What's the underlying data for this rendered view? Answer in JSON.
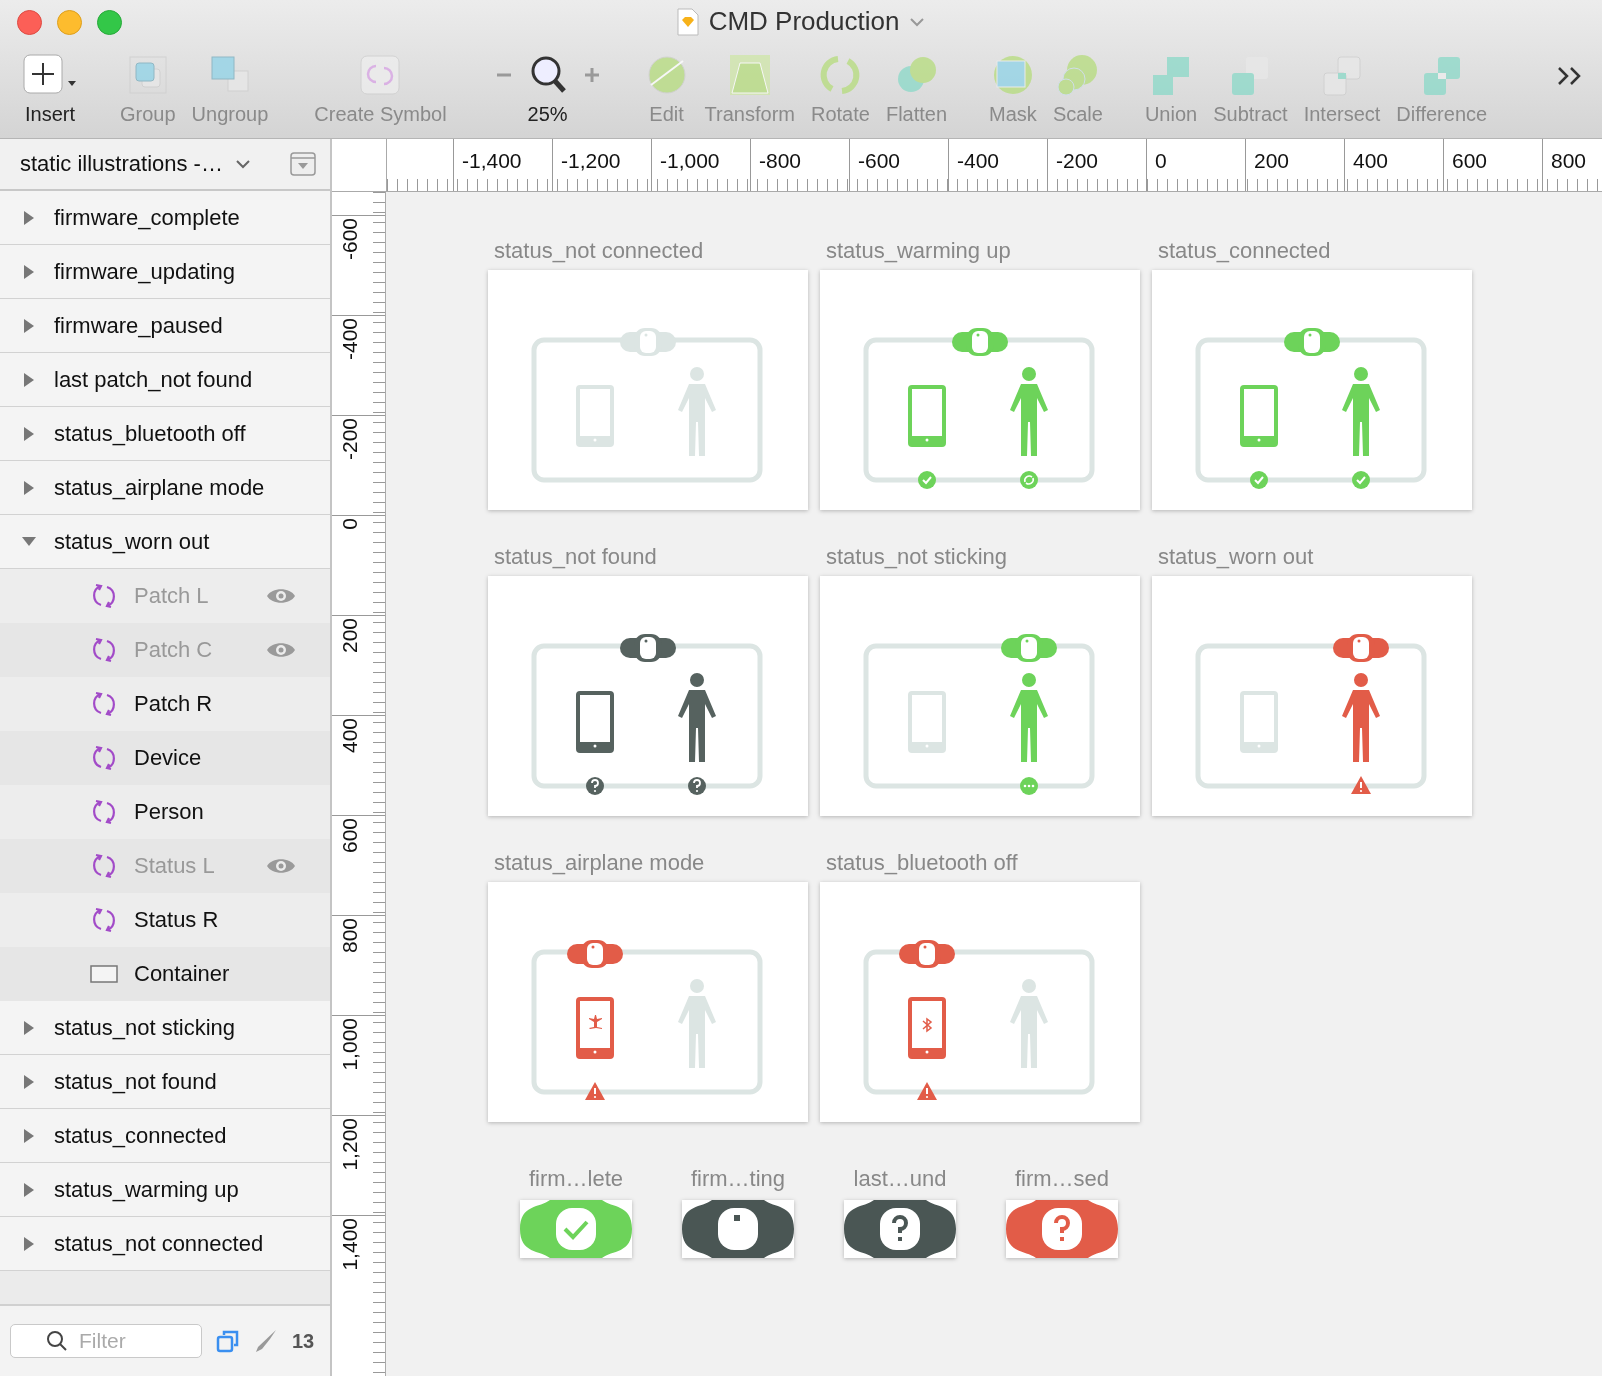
{
  "window": {
    "title": "CMD Production"
  },
  "toolbar": [
    {
      "label": "Insert",
      "kind": "insert",
      "disabled": false
    },
    {
      "label": "Group",
      "kind": "group",
      "disabled": true
    },
    {
      "label": "Ungroup",
      "kind": "ungroup",
      "disabled": true
    },
    {
      "label": "Create Symbol",
      "kind": "symbol",
      "disabled": true
    },
    {
      "label": "25%",
      "kind": "zoom",
      "disabled": false
    },
    {
      "label": "Edit",
      "kind": "edit",
      "disabled": true
    },
    {
      "label": "Transform",
      "kind": "transform",
      "disabled": true
    },
    {
      "label": "Rotate",
      "kind": "rotate",
      "disabled": true
    },
    {
      "label": "Flatten",
      "kind": "flatten",
      "disabled": true
    },
    {
      "label": "Mask",
      "kind": "mask",
      "disabled": true
    },
    {
      "label": "Scale",
      "kind": "scale",
      "disabled": true
    },
    {
      "label": "Union",
      "kind": "union",
      "disabled": true
    },
    {
      "label": "Subtract",
      "kind": "subtract",
      "disabled": true
    },
    {
      "label": "Intersect",
      "kind": "intersect",
      "disabled": true
    },
    {
      "label": "Difference",
      "kind": "difference",
      "disabled": true
    },
    {
      "kind": "overflow",
      "disabled": false
    }
  ],
  "sidebar": {
    "page": "static illustrations -…",
    "layers": [
      {
        "name": "firmware_complete",
        "expanded": false
      },
      {
        "name": "firmware_updating",
        "expanded": false
      },
      {
        "name": "firmware_paused",
        "expanded": false
      },
      {
        "name": "last patch_not found",
        "expanded": false
      },
      {
        "name": "status_bluetooth off",
        "expanded": false
      },
      {
        "name": "status_airplane mode",
        "expanded": false
      },
      {
        "name": "status_worn out",
        "expanded": true,
        "children": [
          {
            "name": "Patch L",
            "kind": "symbol",
            "hidden": true
          },
          {
            "name": "Patch C",
            "kind": "symbol",
            "hidden": true
          },
          {
            "name": "Patch R",
            "kind": "symbol",
            "hidden": false
          },
          {
            "name": "Device",
            "kind": "symbol",
            "hidden": false
          },
          {
            "name": "Person",
            "kind": "symbol",
            "hidden": false
          },
          {
            "name": "Status L",
            "kind": "symbol",
            "hidden": true
          },
          {
            "name": "Status R",
            "kind": "symbol",
            "hidden": false
          },
          {
            "name": "Container",
            "kind": "rectangle",
            "hidden": false
          }
        ]
      },
      {
        "name": "status_not sticking",
        "expanded": false
      },
      {
        "name": "status_not found",
        "expanded": false
      },
      {
        "name": "status_connected",
        "expanded": false
      },
      {
        "name": "status_warming up",
        "expanded": false
      },
      {
        "name": "status_not connected",
        "expanded": false
      }
    ],
    "filter": {
      "placeholder": "Filter"
    },
    "count": "13"
  },
  "rulers": {
    "horizontal": [
      "-1,400",
      "-1,200",
      "-1,000",
      "-800",
      "-600",
      "-400",
      "-200",
      "0",
      "200",
      "400",
      "600",
      "800"
    ],
    "vertical": [
      "-600",
      "-400",
      "-200",
      "0",
      "200",
      "400",
      "600",
      "800",
      "1,000",
      "1,200",
      "1,400"
    ]
  },
  "artboards": [
    {
      "title": "status_not connected",
      "patch": {
        "kind": "center",
        "color": "#dce5e3"
      },
      "phone": {
        "kind": "plain",
        "color": "#dce5e3"
      },
      "person": {
        "color": "#dce5e3"
      }
    },
    {
      "title": "status_warming up",
      "patch": {
        "kind": "center",
        "color": "#6dd35a"
      },
      "phone": {
        "kind": "plain",
        "color": "#6dd35a"
      },
      "person": {
        "color": "#6dd35a"
      },
      "status_left": {
        "kind": "check",
        "color": "#6dd35a"
      },
      "status_right": {
        "kind": "sync",
        "color": "#6dd35a"
      }
    },
    {
      "title": "status_connected",
      "patch": {
        "kind": "center",
        "color": "#6dd35a"
      },
      "phone": {
        "kind": "plain",
        "color": "#6dd35a"
      },
      "person": {
        "color": "#6dd35a"
      },
      "status_left": {
        "kind": "check",
        "color": "#6dd35a"
      },
      "status_right": {
        "kind": "check",
        "color": "#6dd35a"
      }
    },
    {
      "title": "status_not found",
      "patch": {
        "kind": "center",
        "color": "#56625f"
      },
      "phone": {
        "kind": "plain",
        "color": "#56625f"
      },
      "person": {
        "color": "#56625f"
      },
      "status_left": {
        "kind": "question",
        "color": "#56625f"
      },
      "status_right": {
        "kind": "question",
        "color": "#56625f"
      }
    },
    {
      "title": "status_not sticking",
      "patch": {
        "kind": "right",
        "color": "#6dd35a"
      },
      "phone": {
        "kind": "plain",
        "color": "#dce5e3"
      },
      "person": {
        "color": "#6dd35a"
      },
      "status_right": {
        "kind": "dots",
        "color": "#6dd35a"
      }
    },
    {
      "title": "status_worn out",
      "patch": {
        "kind": "right",
        "color": "#e25c48"
      },
      "phone": {
        "kind": "plain",
        "color": "#dce5e3"
      },
      "person": {
        "color": "#e25c48"
      },
      "status_right": {
        "kind": "warning",
        "color": "#e25c48"
      }
    },
    {
      "title": "status_airplane mode",
      "patch": {
        "kind": "left",
        "color": "#e25c48"
      },
      "phone": {
        "kind": "airplane",
        "color": "#e25c48"
      },
      "person": {
        "color": "#dce5e3"
      },
      "status_left": {
        "kind": "warning",
        "color": "#e25c48"
      }
    },
    {
      "title": "status_bluetooth off",
      "patch": {
        "kind": "left",
        "color": "#e25c48"
      },
      "phone": {
        "kind": "bluetooth",
        "color": "#e25c48"
      },
      "person": {
        "color": "#dce5e3"
      },
      "status_left": {
        "kind": "warning",
        "color": "#e25c48"
      }
    }
  ],
  "symbols": [
    {
      "label": "firm…lete",
      "color": "#6dd35a",
      "kind": "check"
    },
    {
      "label": "firm…ting",
      "color": "#4a5654",
      "kind": "dot"
    },
    {
      "label": "last…und",
      "color": "#4a5654",
      "kind": "question"
    },
    {
      "label": "firm…sed",
      "color": "#e25c48",
      "kind": "question"
    }
  ]
}
